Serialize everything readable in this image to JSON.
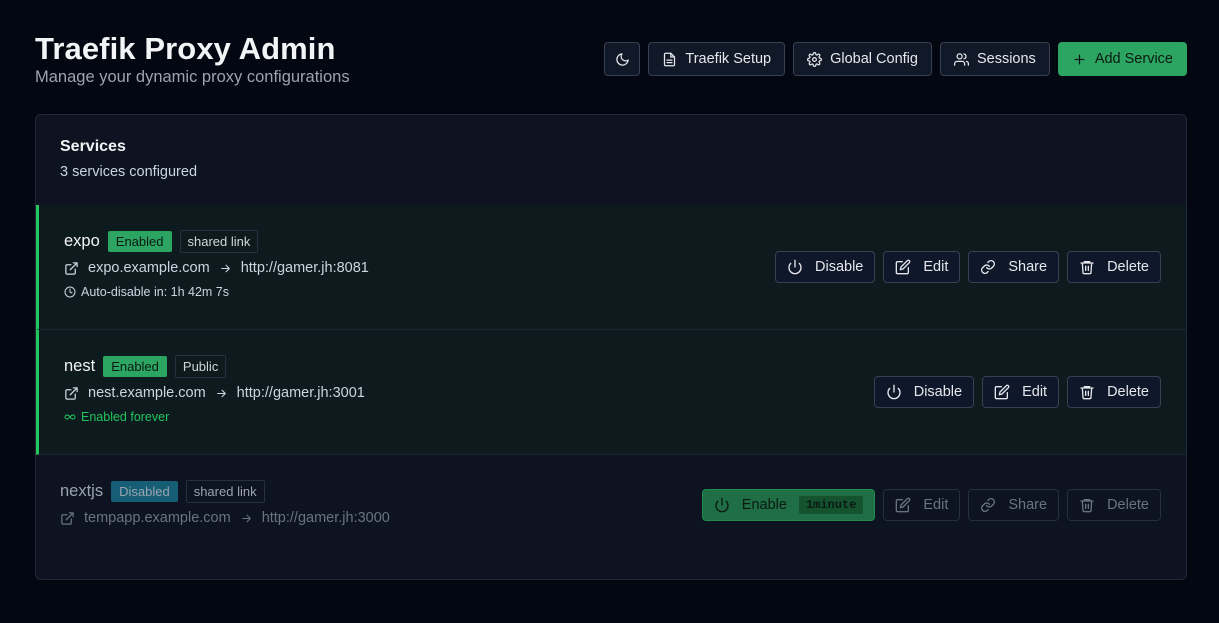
{
  "header": {
    "title": "Traefik Proxy Admin",
    "subtitle": "Manage your dynamic proxy configurations"
  },
  "toolbar": {
    "theme_icon": "moon-icon",
    "setup_label": "Traefik Setup",
    "config_label": "Global Config",
    "sessions_label": "Sessions",
    "add_label": "Add Service"
  },
  "services_panel": {
    "title": "Services",
    "count_text": "3 services configured"
  },
  "services": [
    {
      "name": "expo",
      "status": "Enabled",
      "type": "shared link",
      "host": "expo.example.com",
      "target": "http://gamer.jh:8081",
      "meta": "Auto-disable in: 1h 42m 7s",
      "actions": {
        "toggle": "Disable",
        "edit": "Edit",
        "share": "Share",
        "delete": "Delete"
      }
    },
    {
      "name": "nest",
      "status": "Enabled",
      "type": "Public",
      "host": "nest.example.com",
      "target": "http://gamer.jh:3001",
      "meta": "Enabled forever",
      "actions": {
        "toggle": "Disable",
        "edit": "Edit",
        "delete": "Delete"
      }
    },
    {
      "name": "nextjs",
      "status": "Disabled",
      "type": "shared link",
      "host": "tempapp.example.com",
      "target": "http://gamer.jh:3000",
      "actions": {
        "toggle": "Enable",
        "duration": "1minute",
        "edit": "Edit",
        "share": "Share",
        "delete": "Delete"
      }
    }
  ],
  "colors": {
    "background": "#030712",
    "accent_green": "#2da562",
    "enabled_border": "#22c55e",
    "disabled_badge": "#155e75"
  }
}
